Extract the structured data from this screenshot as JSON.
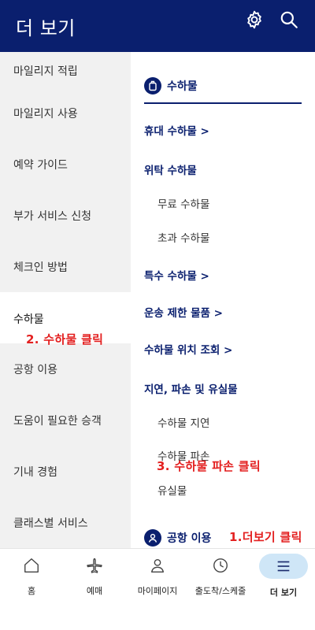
{
  "header": {
    "title": "더 보기",
    "settings_icon": "gear-icon",
    "search_icon": "search-icon"
  },
  "sidebar": {
    "items": [
      {
        "label": "마일리지 적립"
      },
      {
        "label": "마일리지 사용"
      },
      {
        "label": "예약 가이드"
      },
      {
        "label": "부가 서비스 신청"
      },
      {
        "label": "체크인 방법"
      },
      {
        "label": "수하물",
        "active": true
      },
      {
        "label": "공항 이용"
      },
      {
        "label": "도움이 필요한 승객"
      },
      {
        "label": "기내 경험"
      },
      {
        "label": "클래스별 서비스"
      }
    ]
  },
  "content": {
    "section_title": "수하물",
    "section_icon": "luggage-icon",
    "menu": [
      {
        "label": "휴대 수하물 >",
        "type": "bold"
      },
      {
        "label": "위탁 수하물",
        "type": "bold"
      },
      {
        "label": "무료 수하물",
        "type": "sub"
      },
      {
        "label": "초과 수하물",
        "type": "sub"
      },
      {
        "label": "특수 수하물 >",
        "type": "bold"
      },
      {
        "label": "운송 제한 물품 >",
        "type": "bold"
      },
      {
        "label": "수하물 위치 조회 >",
        "type": "bold"
      },
      {
        "label": "지연, 파손 및 유실물",
        "type": "bold"
      },
      {
        "label": "수하물 지연",
        "type": "sub"
      },
      {
        "label": "수하물 파손",
        "type": "sub"
      },
      {
        "label": "유실물",
        "type": "sub"
      }
    ],
    "next_section_title": "공항 이용",
    "next_section_icon": "person-circle-icon"
  },
  "annotations": {
    "step1": "1.더보기 클릭",
    "step2": "2. 수하물 클릭",
    "step3": "3. 수하물 파손 클릭"
  },
  "tabbar": {
    "tabs": [
      {
        "label": "홈",
        "icon": "home-icon"
      },
      {
        "label": "예매",
        "icon": "airplane-icon"
      },
      {
        "label": "마이페이지",
        "icon": "person-icon"
      },
      {
        "label": "출도착/스케줄",
        "icon": "clock-icon"
      },
      {
        "label": "더 보기",
        "icon": "menu-icon",
        "active": true
      }
    ]
  },
  "colors": {
    "brand_navy": "#0a1f6e",
    "annotation_red": "#e32020",
    "active_tab_bg": "#cfe6f7",
    "sidebar_bg": "#f1f1f1"
  }
}
